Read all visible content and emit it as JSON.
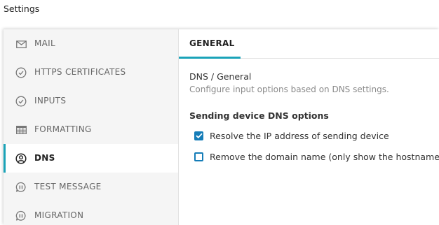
{
  "window": {
    "title": "Settings"
  },
  "sidebar": {
    "items": [
      {
        "label": "MAIL",
        "icon": "mail-icon",
        "active": false
      },
      {
        "label": "HTTPS CERTIFICATES",
        "icon": "check-circle-icon",
        "active": false
      },
      {
        "label": "INPUTS",
        "icon": "check-circle-icon",
        "active": false
      },
      {
        "label": "FORMATTING",
        "icon": "table-icon",
        "active": false
      },
      {
        "label": "DNS",
        "icon": "user-circle-icon",
        "active": true
      },
      {
        "label": "TEST MESSAGE",
        "icon": "message-icon",
        "active": false
      },
      {
        "label": "MIGRATION",
        "icon": "message-icon",
        "active": false
      }
    ]
  },
  "tabs": [
    {
      "label": "GENERAL",
      "active": true
    }
  ],
  "main": {
    "title": "DNS / General",
    "description": "Configure input options based on DNS settings.",
    "group_title": "Sending device DNS options",
    "options": [
      {
        "label": "Resolve the IP address of sending device",
        "checked": true
      },
      {
        "label": "Remove the domain name (only show the hostname)",
        "checked": false
      }
    ]
  },
  "colors": {
    "accent": "#1aa3b8",
    "checkbox": "#157db8",
    "sidebar_bg": "#f5f5f5",
    "muted_text": "#8a8a8a"
  }
}
